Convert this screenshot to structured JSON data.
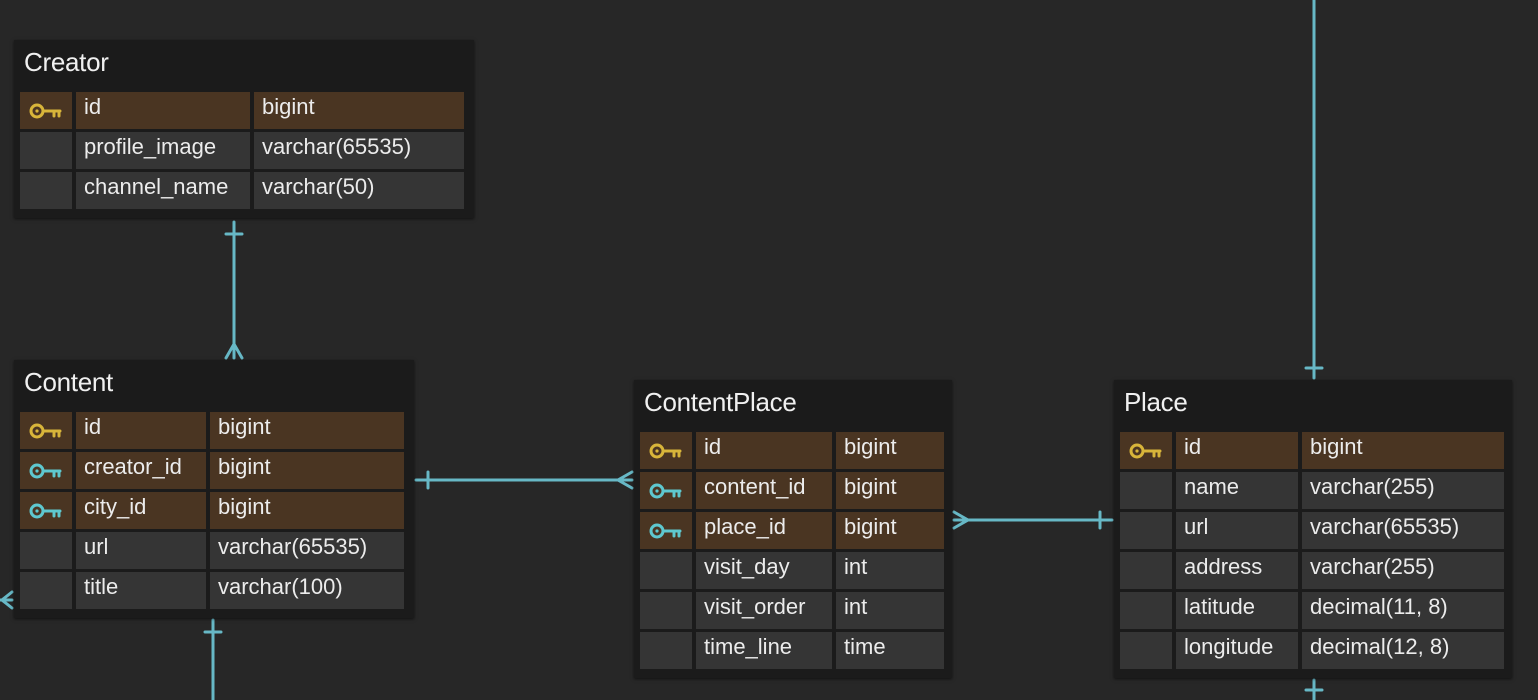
{
  "colors": {
    "background": "#272727",
    "table_bg": "#1b1b1b",
    "cell_bg": "#353535",
    "key_row_bg": "#4a3522",
    "primary_key_icon": "#d8b53a",
    "foreign_key_icon": "#5ec8cf",
    "relation_line": "#67b8c6"
  },
  "tables": {
    "creator": {
      "name": "Creator",
      "columns": [
        {
          "name": "id",
          "type": "bigint",
          "key": "primary-key-icon"
        },
        {
          "name": "profile_image",
          "type": "varchar(65535)",
          "key": ""
        },
        {
          "name": "channel_name",
          "type": "varchar(50)",
          "key": ""
        }
      ]
    },
    "content": {
      "name": "Content",
      "columns": [
        {
          "name": "id",
          "type": "bigint",
          "key": "primary-key-icon"
        },
        {
          "name": "creator_id",
          "type": "bigint",
          "key": "foreign-key-icon"
        },
        {
          "name": "city_id",
          "type": "bigint",
          "key": "foreign-key-icon"
        },
        {
          "name": "url",
          "type": "varchar(65535)",
          "key": ""
        },
        {
          "name": "title",
          "type": "varchar(100)",
          "key": ""
        }
      ]
    },
    "content_place": {
      "name": "ContentPlace",
      "columns": [
        {
          "name": "id",
          "type": "bigint",
          "key": "primary-key-icon"
        },
        {
          "name": "content_id",
          "type": "bigint",
          "key": "foreign-key-icon"
        },
        {
          "name": "place_id",
          "type": "bigint",
          "key": "foreign-key-icon"
        },
        {
          "name": "visit_day",
          "type": "int",
          "key": ""
        },
        {
          "name": "visit_order",
          "type": "int",
          "key": ""
        },
        {
          "name": "time_line",
          "type": "time",
          "key": ""
        }
      ]
    },
    "place": {
      "name": "Place",
      "columns": [
        {
          "name": "id",
          "type": "bigint",
          "key": "primary-key-icon"
        },
        {
          "name": "name",
          "type": "varchar(255)",
          "key": ""
        },
        {
          "name": "url",
          "type": "varchar(65535)",
          "key": ""
        },
        {
          "name": "address",
          "type": "varchar(255)",
          "key": ""
        },
        {
          "name": "latitude",
          "type": "decimal(11, 8)",
          "key": ""
        },
        {
          "name": "longitude",
          "type": "decimal(12, 8)",
          "key": ""
        }
      ]
    }
  }
}
